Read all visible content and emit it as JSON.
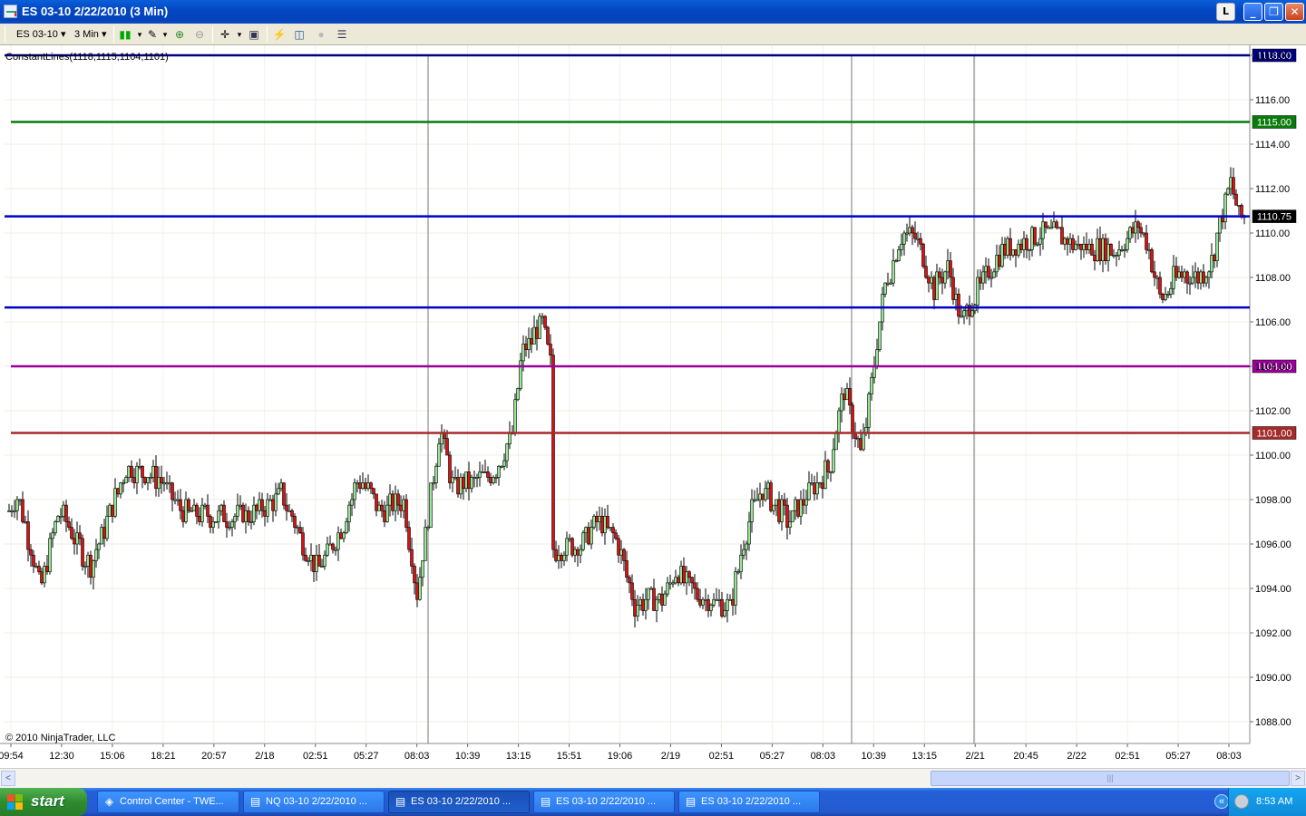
{
  "window": {
    "title": "ES 03-10  2/22/2010 (3 Min)",
    "buttons": {
      "layout": "L",
      "minimize": "_",
      "maximize": "❐",
      "close": "✕"
    }
  },
  "toolbar": {
    "instrument": "ES 03-10",
    "interval": "3 Min",
    "icons": [
      "bar-type-icon",
      "draw-tool-icon",
      "zoom-in-icon",
      "zoom-out-icon",
      "crosshair-icon",
      "properties-icon",
      "indicators-icon",
      "strategies-icon",
      "disabled-icon",
      "data-box-icon"
    ]
  },
  "chart_data": {
    "type": "candlestick",
    "indicator_label": "ConstantLines(1118,1115,1104,1101)",
    "copyright": "© 2010 NinjaTrader, LLC",
    "y_axis": {
      "ticks": [
        "1118.00",
        "1116.00",
        "1114.00",
        "1112.00",
        "1110.00",
        "1108.00",
        "1106.00",
        "1104.00",
        "1102.00",
        "1100.00",
        "1098.00",
        "1096.00",
        "1094.00",
        "1092.00",
        "1090.00",
        "1088.00"
      ],
      "range": [
        1087.3,
        1118.3
      ]
    },
    "x_axis": {
      "ticks": [
        "09:54",
        "12:30",
        "15:06",
        "18:21",
        "20:57",
        "2/18",
        "02:51",
        "05:27",
        "08:03",
        "10:39",
        "13:15",
        "15:51",
        "19:06",
        "2/19",
        "02:51",
        "05:27",
        "08:03",
        "10:39",
        "13:15",
        "2/21",
        "20:45",
        "2/22",
        "02:51",
        "05:27",
        "08:03"
      ]
    },
    "session_breaks": [
      "2/18 09:30",
      "2/19 09:30",
      "2/21 18:00"
    ],
    "horizontal_lines": [
      {
        "value": 1118.0,
        "label": "1118.00",
        "color": "#000080"
      },
      {
        "value": 1115.0,
        "label": "1115.00",
        "color": "#0a7a0a"
      },
      {
        "value": 1110.75,
        "label": "1110.75",
        "color": "#0000cc"
      },
      {
        "value": 1106.65,
        "label": "",
        "color": "#0000cc"
      },
      {
        "value": 1104.0,
        "label": "1104.00",
        "color": "#990099"
      },
      {
        "value": 1101.0,
        "label": "1101.00",
        "color": "#a52a2a"
      }
    ],
    "last_price": "1110.75",
    "price_path": [
      [
        0,
        1096.8
      ],
      [
        20,
        1098.2
      ],
      [
        45,
        1094.0
      ],
      [
        65,
        1097.5
      ],
      [
        100,
        1095.0
      ],
      [
        140,
        1099.5
      ],
      [
        180,
        1098.8
      ],
      [
        200,
        1097.4
      ],
      [
        240,
        1097.2
      ],
      [
        280,
        1097.4
      ],
      [
        310,
        1098.2
      ],
      [
        350,
        1094.8
      ],
      [
        375,
        1096.5
      ],
      [
        395,
        1099.0
      ],
      [
        420,
        1097.5
      ],
      [
        445,
        1098.0
      ],
      [
        460,
        1093.8
      ],
      [
        485,
        1101.2
      ],
      [
        500,
        1098.5
      ],
      [
        545,
        1099.2
      ],
      [
        565,
        1101.0
      ],
      [
        575,
        1104.5
      ],
      [
        598,
        1106.0
      ],
      [
        607,
        1104.0
      ],
      [
        610,
        1095.8
      ],
      [
        640,
        1096.0
      ],
      [
        660,
        1097.0
      ],
      [
        680,
        1096.2
      ],
      [
        700,
        1093.3
      ],
      [
        730,
        1093.6
      ],
      [
        745,
        1094.8
      ],
      [
        770,
        1093.6
      ],
      [
        805,
        1093.2
      ],
      [
        825,
        1097.0
      ],
      [
        840,
        1098.5
      ],
      [
        870,
        1097.0
      ],
      [
        895,
        1098.5
      ],
      [
        915,
        1099.5
      ],
      [
        930,
        1103.0
      ],
      [
        950,
        1100.0
      ],
      [
        975,
        1107.5
      ],
      [
        995,
        1110.0
      ],
      [
        1010,
        1109.8
      ],
      [
        1030,
        1107.5
      ],
      [
        1045,
        1108.5
      ],
      [
        1060,
        1106.0
      ],
      [
        1080,
        1107.5
      ],
      [
        1100,
        1109.0
      ],
      [
        1130,
        1109.7
      ],
      [
        1160,
        1110.0
      ],
      [
        1190,
        1109.4
      ],
      [
        1230,
        1109.2
      ],
      [
        1255,
        1110.3
      ],
      [
        1265,
        1109.5
      ],
      [
        1280,
        1107.0
      ],
      [
        1300,
        1108.2
      ],
      [
        1320,
        1108.0
      ],
      [
        1335,
        1108.6
      ],
      [
        1345,
        1110.5
      ],
      [
        1357,
        1112.2
      ],
      [
        1366,
        1110.8
      ],
      [
        1373,
        1110.75
      ]
    ]
  },
  "scrollbar": {
    "left_arrow": "<",
    "right_arrow": ">",
    "grip": "|||"
  },
  "taskbar": {
    "start_label": "start",
    "tasks": [
      {
        "label": "Control Center - TWE...",
        "active": false
      },
      {
        "label": "NQ 03-10  2/22/2010 ...",
        "active": false
      },
      {
        "label": "ES 03-10  2/22/2010 ...",
        "active": true
      },
      {
        "label": "ES 03-10  2/22/2010 ...",
        "active": false
      },
      {
        "label": "ES 03-10  2/22/2010 ...",
        "active": false
      }
    ],
    "chevron": "«",
    "clock": "8:53 AM"
  }
}
